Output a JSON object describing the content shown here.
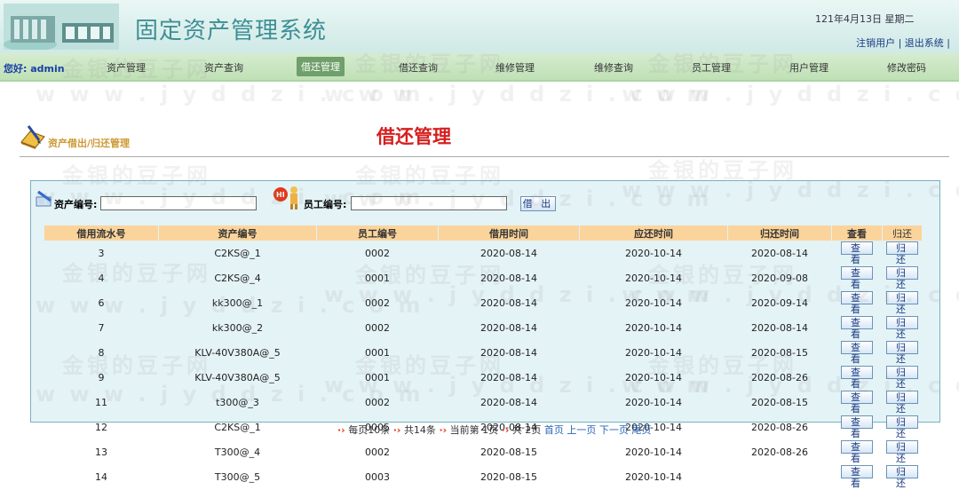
{
  "header": {
    "title": "固定资产管理系统",
    "date": "121年4月13日   星期二",
    "logout_user": "注销用户",
    "exit_system": "退出系统"
  },
  "nav": {
    "welcome": "您好: admin",
    "items": [
      "资产管理",
      "资产查询",
      "借还管理",
      "借还查询",
      "维修管理",
      "维修查询",
      "员工管理",
      "用户管理",
      "修改密码"
    ],
    "active": "借还管理"
  },
  "breadcrumb": "资产借出/归还管理",
  "page_title": "借还管理",
  "search": {
    "asset_label": "资产编号:",
    "asset_value": "",
    "employee_label": "员工编号:",
    "employee_value": "",
    "lend_button": "借 出"
  },
  "table": {
    "headers": [
      "借用流水号",
      "资产编号",
      "员工编号",
      "借用时间",
      "应还时间",
      "归还时间",
      "查看",
      "归还"
    ],
    "rows": [
      [
        "3",
        "C2KS@_1",
        "0002",
        "2020-08-14",
        "2020-10-14",
        "2020-08-14"
      ],
      [
        "4",
        "C2KS@_4",
        "0001",
        "2020-08-14",
        "2020-10-14",
        "2020-09-08"
      ],
      [
        "6",
        "kk300@_1",
        "0002",
        "2020-08-14",
        "2020-10-14",
        "2020-09-14"
      ],
      [
        "7",
        "kk300@_2",
        "0002",
        "2020-08-14",
        "2020-10-14",
        "2020-08-14"
      ],
      [
        "8",
        "KLV-40V380A@_5",
        "0001",
        "2020-08-14",
        "2020-10-14",
        "2020-08-15"
      ],
      [
        "9",
        "KLV-40V380A@_5",
        "0001",
        "2020-08-14",
        "2020-10-14",
        "2020-08-26"
      ],
      [
        "11",
        "t300@_3",
        "0002",
        "2020-08-14",
        "2020-10-14",
        "2020-08-15"
      ],
      [
        "12",
        "C2KS@_1",
        "0005",
        "2020-08-14",
        "2020-10-14",
        "2020-08-26"
      ],
      [
        "13",
        "T300@_4",
        "0002",
        "2020-08-15",
        "2020-10-14",
        "2020-08-26"
      ],
      [
        "14",
        "T300@_5",
        "0003",
        "2020-08-15",
        "2020-10-14",
        ""
      ]
    ],
    "view_label": "查 看",
    "return_label": "归 还"
  },
  "pager": {
    "per_page": "每页10条",
    "total": "共14条",
    "current": "当前第 1页",
    "pages": "共 2页",
    "first": "首页",
    "prev": "上一页",
    "next": "下一页",
    "last": "尾页"
  },
  "watermark": {
    "cn": "金银的豆子网",
    "url": "w w w . j y d d z i . c o m"
  },
  "colors": {
    "title": "#3e8f95",
    "page_title": "#d61e1e",
    "header_row": "#fbd49b",
    "panel": "#e4f3f6",
    "nav": "#bfe0b5"
  }
}
